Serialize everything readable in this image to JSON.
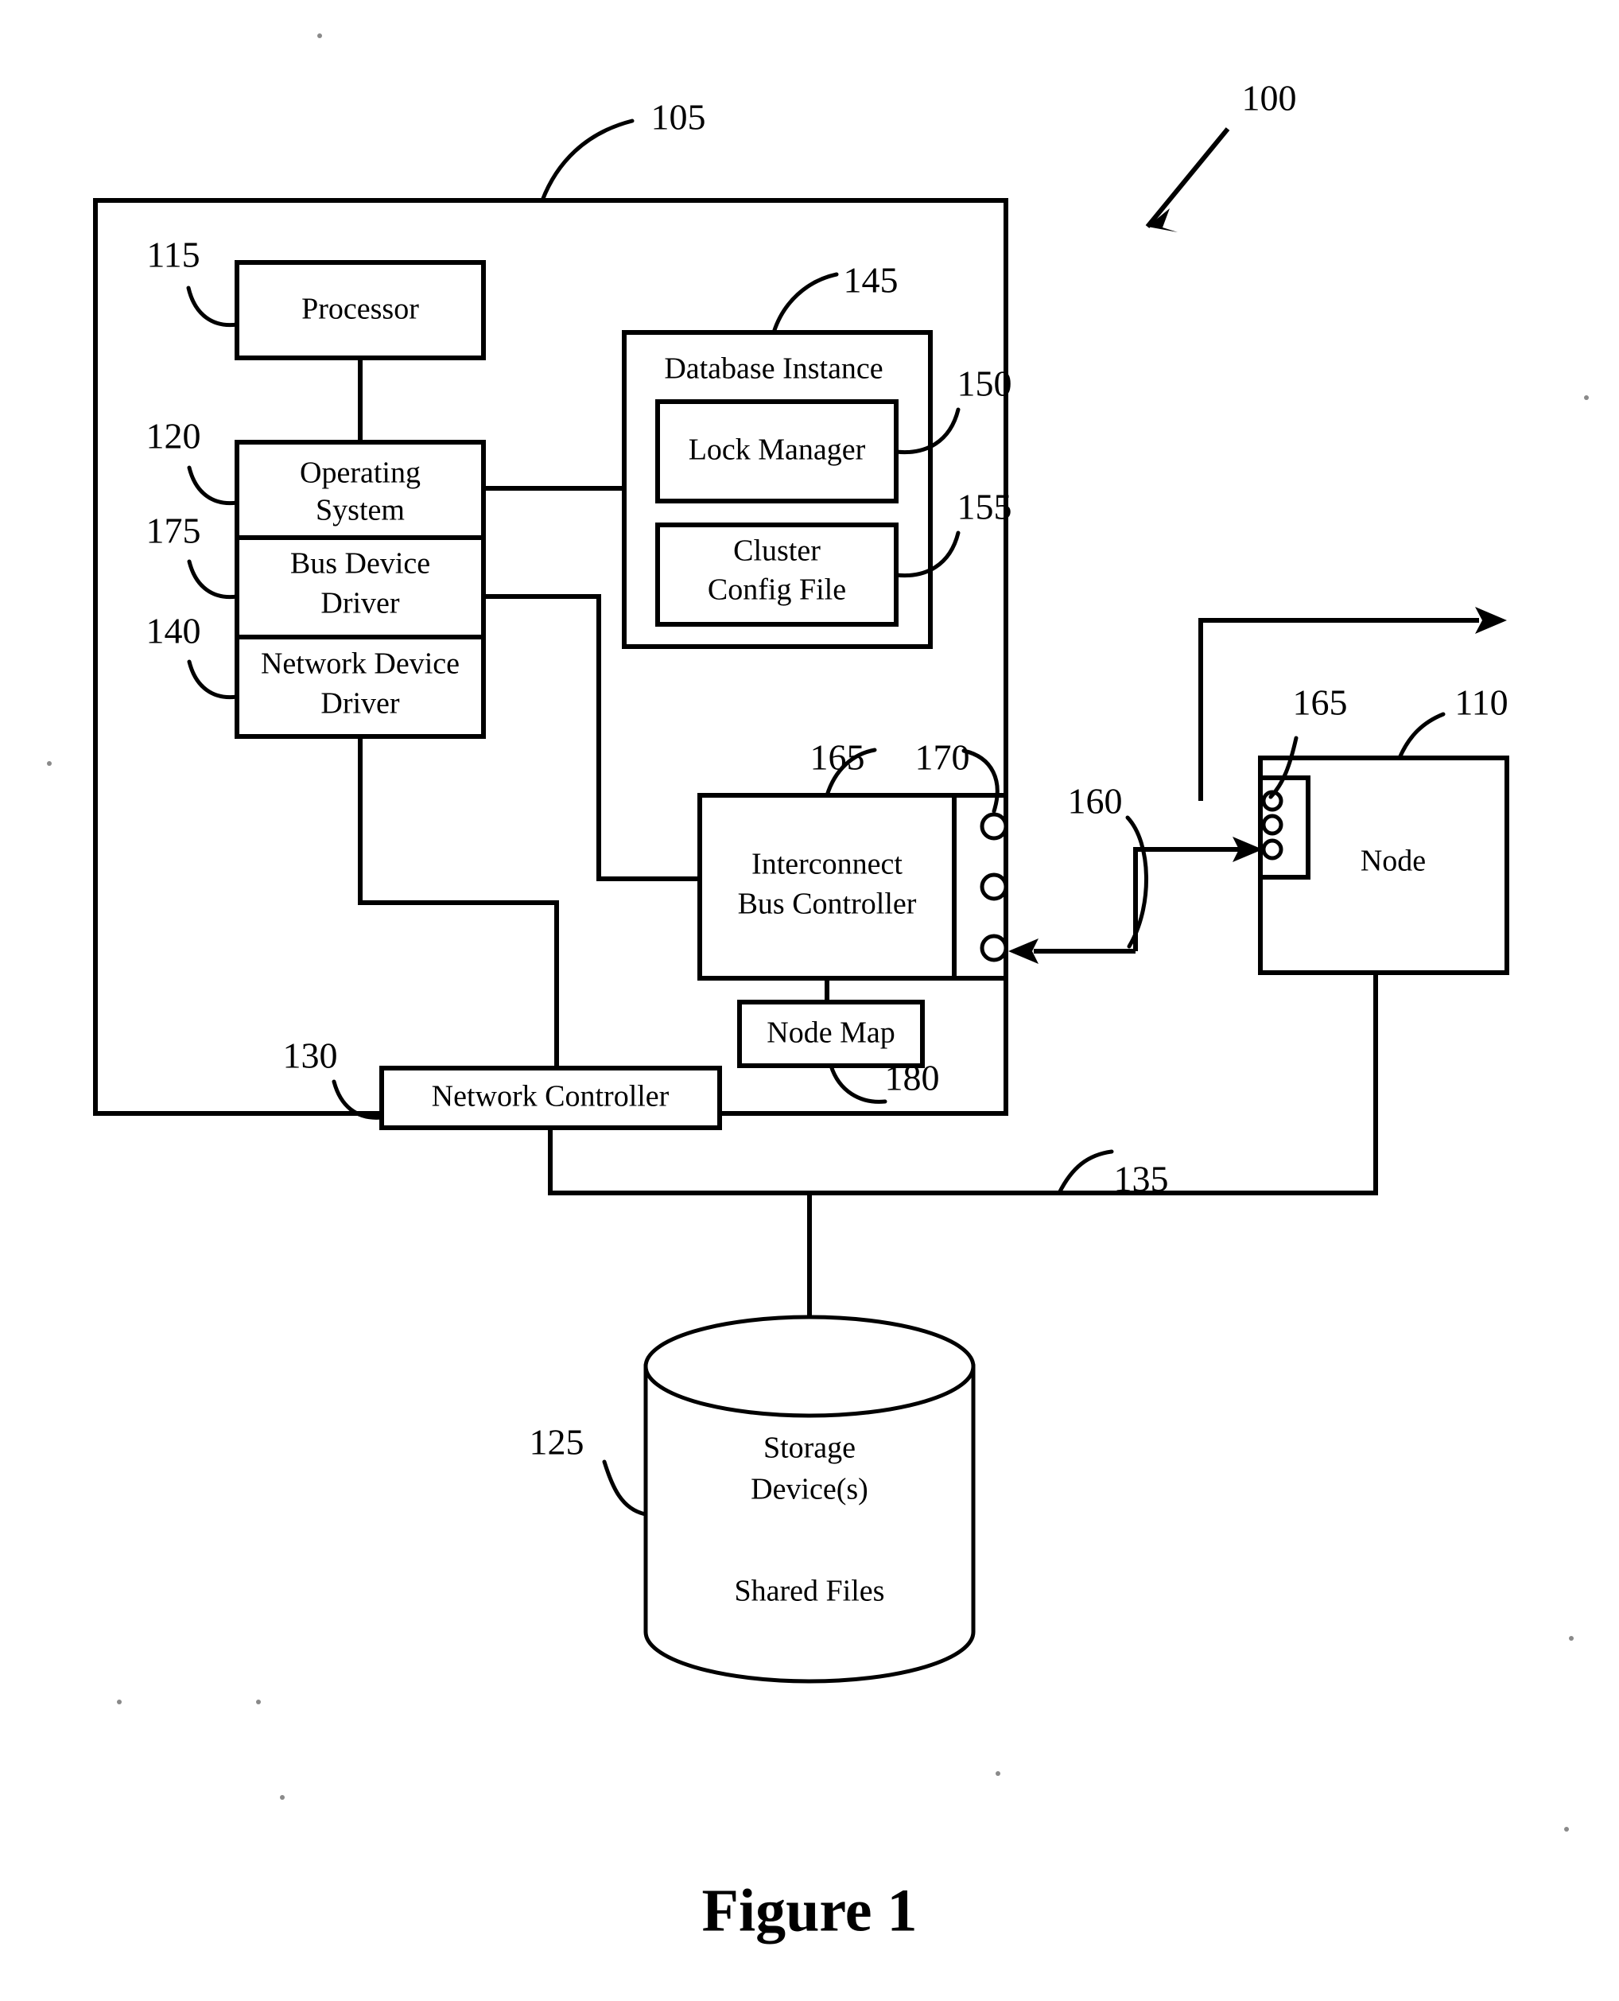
{
  "figure": {
    "caption": "Figure 1",
    "system_ref": "100"
  },
  "nodes": {
    "host": {
      "ref": "105"
    },
    "processor": {
      "label": "Processor",
      "ref": "115"
    },
    "operating_system": {
      "label_line1": "Operating",
      "label_line2": "System",
      "ref": "120"
    },
    "bus_device_driver": {
      "label_line1": "Bus Device",
      "label_line2": "Driver",
      "ref": "175"
    },
    "network_device_driver": {
      "label_line1": "Network Device",
      "label_line2": "Driver",
      "ref": "140"
    },
    "database_instance": {
      "label": "Database Instance",
      "ref": "145"
    },
    "lock_manager": {
      "label": "Lock Manager",
      "ref": "150"
    },
    "cluster_config_file": {
      "label_line1": "Cluster",
      "label_line2": "Config File",
      "ref": "155"
    },
    "interconnect_bus_controller": {
      "label_line1": "Interconnect",
      "label_line2": "Bus Controller",
      "ref": "165",
      "ports_ref": "170"
    },
    "node_map": {
      "label": "Node Map",
      "ref": "180"
    },
    "network_controller": {
      "label": "Network Controller",
      "ref": "130"
    },
    "remote_node": {
      "label": "Node",
      "ref": "110",
      "ports_ref": "165"
    },
    "storage_device": {
      "label_line1": "Storage",
      "label_line2": "Device(s)",
      "label_line3": "Shared Files",
      "ref": "125"
    }
  },
  "connections": {
    "interconnect_link": {
      "ref": "160"
    },
    "network_link": {
      "ref": "135"
    }
  }
}
